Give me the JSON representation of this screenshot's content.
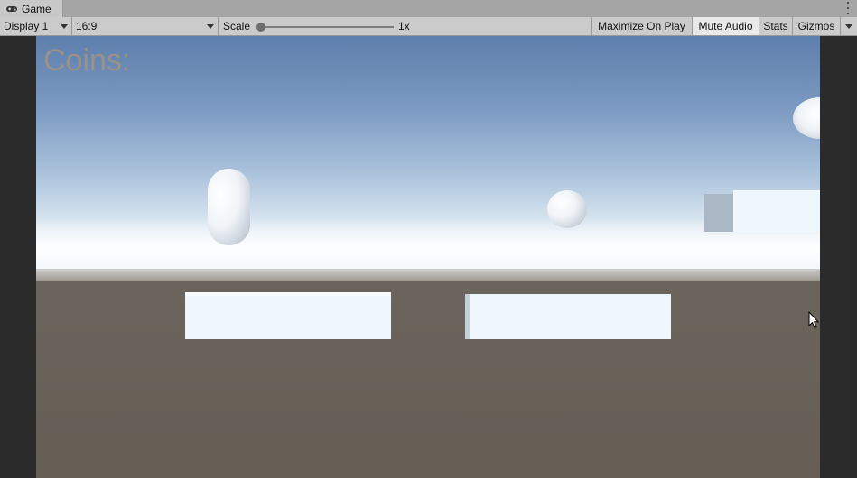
{
  "window": {
    "tab_title": "Game",
    "tab_icon": "gamepad-icon",
    "menu_icon": "kebab-menu-icon"
  },
  "toolbar": {
    "display_label": "Display 1",
    "aspect_label": "16:9",
    "scale_label": "Scale",
    "scale_value": "1x",
    "scale_level": 0.0,
    "maximize_label": "Maximize On Play",
    "mute_label": "Mute Audio",
    "mute_active": true,
    "stats_label": "Stats",
    "gizmos_label": "Gizmos"
  },
  "game_view": {
    "hud": {
      "coins_label": "Coins:"
    },
    "colors": {
      "sky_top": "#5d7fab",
      "horizon": "#f3f7fa",
      "ground": "#6b645c",
      "object": "#eef7fb",
      "hud_text": "#9a9189"
    }
  }
}
